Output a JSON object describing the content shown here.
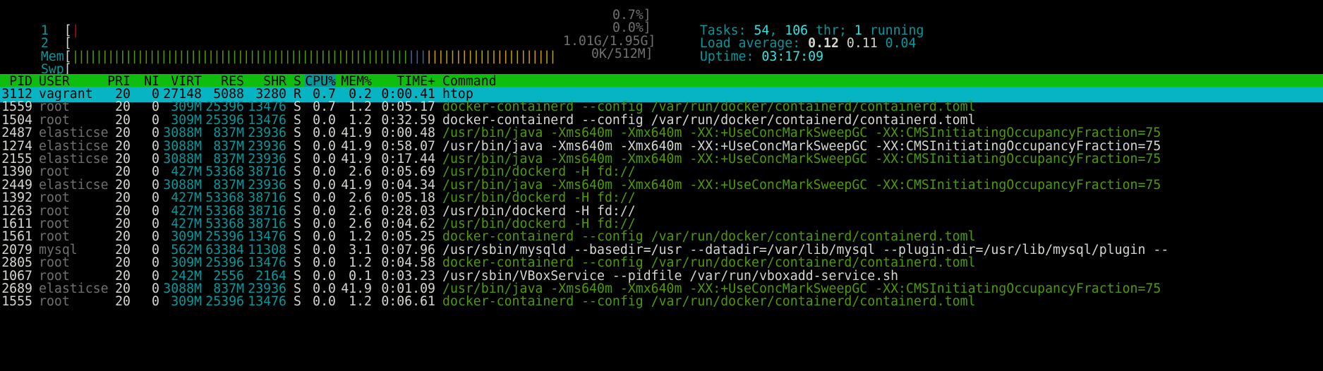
{
  "meters": {
    "cpu1": {
      "label": "1",
      "open": "[",
      "bar": "|",
      "value": "0.7%]"
    },
    "cpu2": {
      "label": "2",
      "open": "[",
      "bar": "",
      "value": "0.0%]"
    },
    "mem": {
      "label": "Mem",
      "open": "[",
      "bar_green": "|||||||||||||||||||||||||||||||||||||||||||||||||||||||||",
      "bar_blue": "|||",
      "bar_yellow": "||||||||||||||||||||||",
      "value": "1.01G/1.95G]"
    },
    "swp": {
      "label": "Swp",
      "open": "[",
      "value": "0K/512M]"
    }
  },
  "summary": {
    "tasks_label": "Tasks: ",
    "tasks": "54",
    "thr_sep": ", ",
    "thr": "106",
    "thr_label": " thr; ",
    "running": "1",
    "running_label": " running",
    "load_label": "Load average: ",
    "load1": "0.12",
    "load5": "0.11",
    "load15": "0.04",
    "uptime_label": "Uptime: ",
    "uptime": "03:17:09"
  },
  "columns": {
    "pid": "PID",
    "user": "USER",
    "pri": "PRI",
    "ni": "NI",
    "virt": "VIRT",
    "res": "RES",
    "shr": "SHR",
    "s": "S",
    "cpu": "CPU%",
    "mem": "MEM%",
    "time": "TIME+",
    "command": "Command"
  },
  "rows": [
    {
      "pid": "3112",
      "user": "vagrant",
      "pri": "20",
      "ni": "0",
      "virt": "27148",
      "res": "5088",
      "shr": "3280",
      "s": "R",
      "cpu": "0.7",
      "mem": "0.2",
      "time": "0:00.41",
      "command": "htop"
    },
    {
      "pid": "1559",
      "user": "root",
      "pri": "20",
      "ni": "0",
      "virt": "309M",
      "res": "25396",
      "shr": "13476",
      "s": "S",
      "cpu": "0.7",
      "mem": "1.2",
      "time": "0:05.17",
      "command": "docker-containerd --config /var/run/docker/containerd/containerd.toml"
    },
    {
      "pid": "1504",
      "user": "root",
      "pri": "20",
      "ni": "0",
      "virt": "309M",
      "res": "25396",
      "shr": "13476",
      "s": "S",
      "cpu": "0.0",
      "mem": "1.2",
      "time": "0:32.59",
      "command": "docker-containerd --config /var/run/docker/containerd/containerd.toml"
    },
    {
      "pid": "2487",
      "user": "elasticse",
      "pri": "20",
      "ni": "0",
      "virt": "3088M",
      "res": "837M",
      "shr": "23936",
      "s": "S",
      "cpu": "0.0",
      "mem": "41.9",
      "time": "0:00.48",
      "command": "/usr/bin/java -Xms640m -Xmx640m -XX:+UseConcMarkSweepGC -XX:CMSInitiatingOccupancyFraction=75"
    },
    {
      "pid": "1274",
      "user": "elasticse",
      "pri": "20",
      "ni": "0",
      "virt": "3088M",
      "res": "837M",
      "shr": "23936",
      "s": "S",
      "cpu": "0.0",
      "mem": "41.9",
      "time": "0:58.07",
      "command": "/usr/bin/java -Xms640m -Xmx640m -XX:+UseConcMarkSweepGC -XX:CMSInitiatingOccupancyFraction=75"
    },
    {
      "pid": "2155",
      "user": "elasticse",
      "pri": "20",
      "ni": "0",
      "virt": "3088M",
      "res": "837M",
      "shr": "23936",
      "s": "S",
      "cpu": "0.0",
      "mem": "41.9",
      "time": "0:17.44",
      "command": "/usr/bin/java -Xms640m -Xmx640m -XX:+UseConcMarkSweepGC -XX:CMSInitiatingOccupancyFraction=75"
    },
    {
      "pid": "1390",
      "user": "root",
      "pri": "20",
      "ni": "0",
      "virt": "427M",
      "res": "53368",
      "shr": "38716",
      "s": "S",
      "cpu": "0.0",
      "mem": "2.6",
      "time": "0:05.69",
      "command": "/usr/bin/dockerd -H fd://"
    },
    {
      "pid": "2449",
      "user": "elasticse",
      "pri": "20",
      "ni": "0",
      "virt": "3088M",
      "res": "837M",
      "shr": "23936",
      "s": "S",
      "cpu": "0.0",
      "mem": "41.9",
      "time": "0:04.34",
      "command": "/usr/bin/java -Xms640m -Xmx640m -XX:+UseConcMarkSweepGC -XX:CMSInitiatingOccupancyFraction=75"
    },
    {
      "pid": "1392",
      "user": "root",
      "pri": "20",
      "ni": "0",
      "virt": "427M",
      "res": "53368",
      "shr": "38716",
      "s": "S",
      "cpu": "0.0",
      "mem": "2.6",
      "time": "0:05.18",
      "command": "/usr/bin/dockerd -H fd://"
    },
    {
      "pid": "1263",
      "user": "root",
      "pri": "20",
      "ni": "0",
      "virt": "427M",
      "res": "53368",
      "shr": "38716",
      "s": "S",
      "cpu": "0.0",
      "mem": "2.6",
      "time": "0:28.03",
      "command": "/usr/bin/dockerd -H fd://"
    },
    {
      "pid": "1611",
      "user": "root",
      "pri": "20",
      "ni": "0",
      "virt": "427M",
      "res": "53368",
      "shr": "38716",
      "s": "S",
      "cpu": "0.0",
      "mem": "2.6",
      "time": "0:04.62",
      "command": "/usr/bin/dockerd -H fd://"
    },
    {
      "pid": "1561",
      "user": "root",
      "pri": "20",
      "ni": "0",
      "virt": "309M",
      "res": "25396",
      "shr": "13476",
      "s": "S",
      "cpu": "0.0",
      "mem": "1.2",
      "time": "0:05.25",
      "command": "docker-containerd --config /var/run/docker/containerd/containerd.toml"
    },
    {
      "pid": "2079",
      "user": "mysql",
      "pri": "20",
      "ni": "0",
      "virt": "562M",
      "res": "63384",
      "shr": "11308",
      "s": "S",
      "cpu": "0.0",
      "mem": "3.1",
      "time": "0:07.96",
      "command": "/usr/sbin/mysqld --basedir=/usr --datadir=/var/lib/mysql --plugin-dir=/usr/lib/mysql/plugin --"
    },
    {
      "pid": "2805",
      "user": "root",
      "pri": "20",
      "ni": "0",
      "virt": "309M",
      "res": "25396",
      "shr": "13476",
      "s": "S",
      "cpu": "0.0",
      "mem": "1.2",
      "time": "0:04.58",
      "command": "docker-containerd --config /var/run/docker/containerd/containerd.toml"
    },
    {
      "pid": "1067",
      "user": "root",
      "pri": "20",
      "ni": "0",
      "virt": "242M",
      "res": "2556",
      "shr": "2164",
      "s": "S",
      "cpu": "0.0",
      "mem": "0.1",
      "time": "0:03.23",
      "command": "/usr/sbin/VBoxService --pidfile /var/run/vboxadd-service.sh"
    },
    {
      "pid": "2689",
      "user": "elasticse",
      "pri": "20",
      "ni": "0",
      "virt": "3088M",
      "res": "837M",
      "shr": "23936",
      "s": "S",
      "cpu": "0.0",
      "mem": "41.9",
      "time": "0:01.09",
      "command": "/usr/bin/java -Xms640m -Xmx640m -XX:+UseConcMarkSweepGC -XX:CMSInitiatingOccupancyFraction=75"
    },
    {
      "pid": "1555",
      "user": "root",
      "pri": "20",
      "ni": "0",
      "virt": "309M",
      "res": "25396",
      "shr": "13476",
      "s": "S",
      "cpu": "0.0",
      "mem": "1.2",
      "time": "0:06.61",
      "command": "docker-containerd --config /var/run/docker/containerd/containerd.toml"
    }
  ],
  "row_styles": {
    "thread_command_color": "#4e9a06",
    "process_command_color": "#d3d7cf",
    "header_bg": "#0ebd0e",
    "sort_column_bg": "#06989a",
    "selected_row_bg": "#06b4c4"
  }
}
